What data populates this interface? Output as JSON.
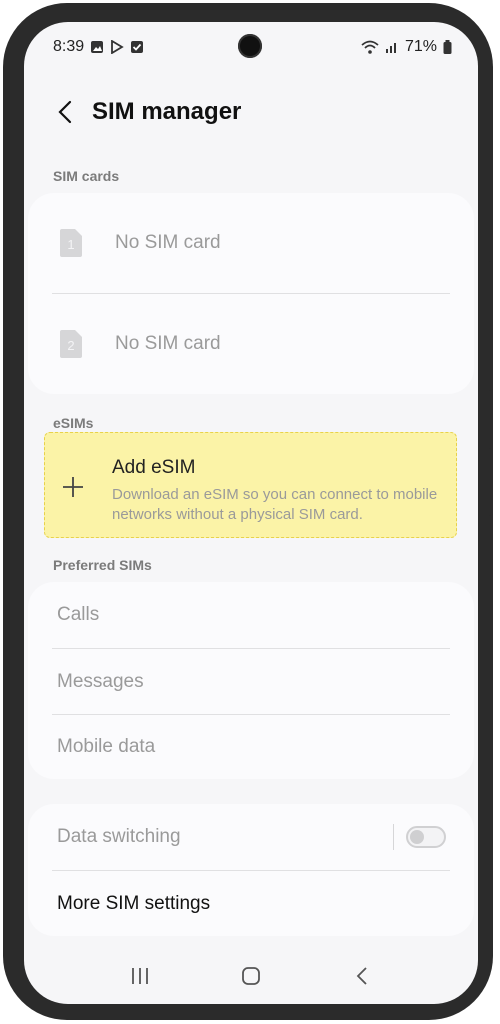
{
  "status_bar": {
    "time": "8:39",
    "battery": "71%",
    "icons_left": [
      "gallery-icon",
      "play-store-icon",
      "checkbox-icon"
    ],
    "icons_right": [
      "wifi-icon",
      "signal-icon",
      "battery-icon"
    ]
  },
  "header": {
    "title": "SIM manager",
    "back_icon": "back-arrow-icon"
  },
  "sim_cards": {
    "label": "SIM cards",
    "items": [
      {
        "slot": "1",
        "text": "No SIM card"
      },
      {
        "slot": "2",
        "text": "No SIM card"
      }
    ]
  },
  "esims": {
    "label": "eSIMs",
    "add_title": "Add eSIM",
    "add_description": "Download an eSIM so you can connect to mobile networks without a physical SIM card.",
    "highlight_color": "#fbf3a7"
  },
  "preferred_sims": {
    "label": "Preferred SIMs",
    "items": [
      "Calls",
      "Messages",
      "Mobile data"
    ]
  },
  "other": {
    "data_switching": "Data switching",
    "data_switching_on": false,
    "more_settings": "More SIM settings"
  },
  "nav": {
    "recent": "recent-apps-icon",
    "home": "home-icon",
    "back": "back-icon"
  }
}
